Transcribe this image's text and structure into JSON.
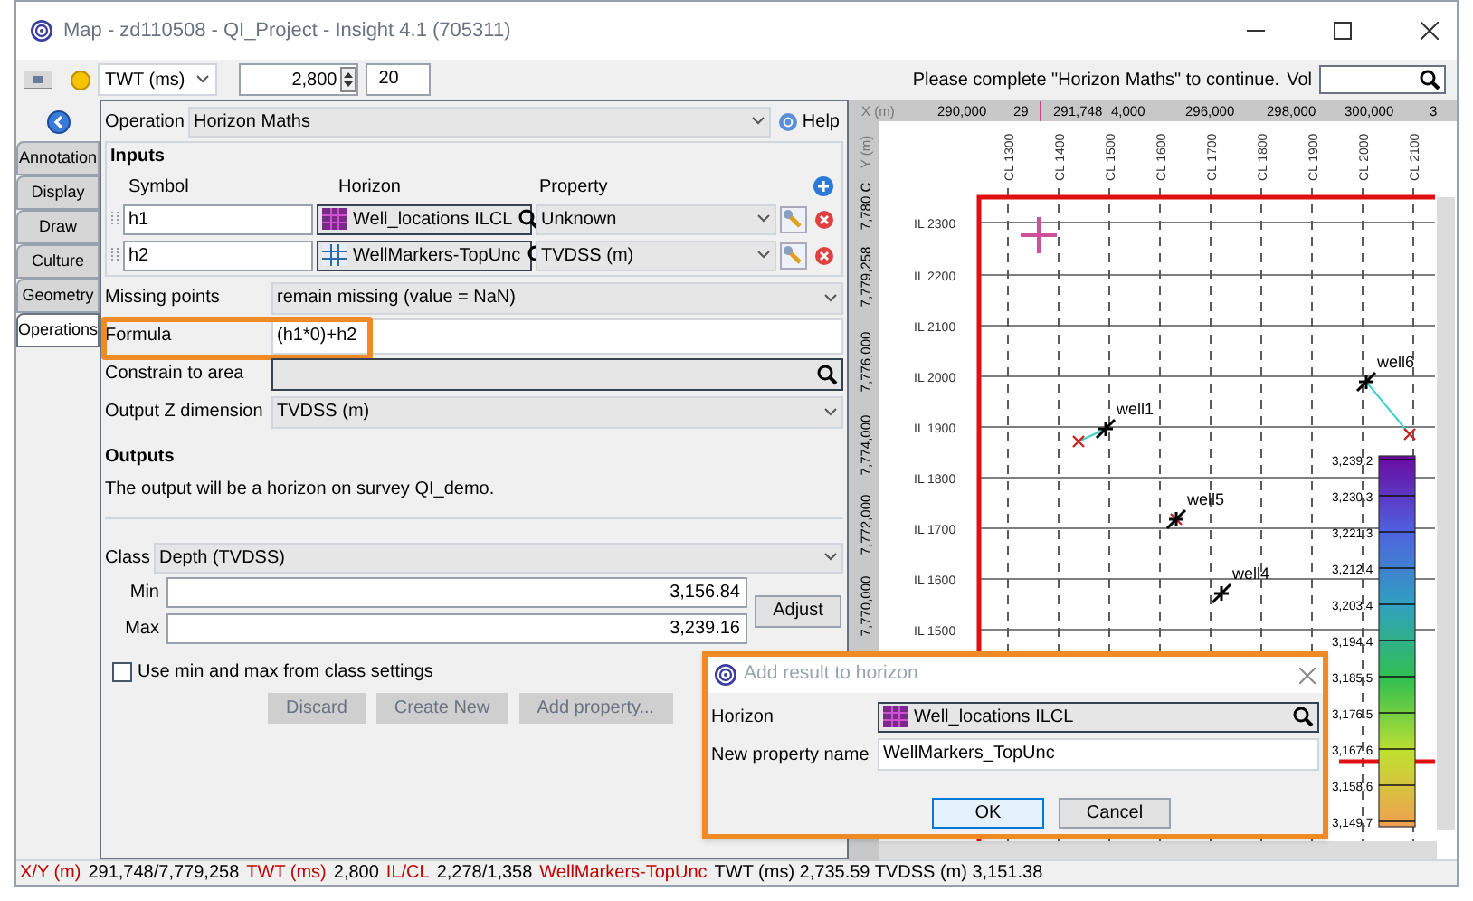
{
  "window": {
    "title": "Map - zd110508 - QI_Project - Insight 4.1 (705311)"
  },
  "toolbar": {
    "domain": "TWT (ms)",
    "value": "2,800",
    "step": "20",
    "message": "Please complete \"Horizon Maths\" to continue.",
    "vol_label": "Vol"
  },
  "side_tabs": [
    {
      "label": "Annotation",
      "selected": false
    },
    {
      "label": "Display",
      "selected": false
    },
    {
      "label": "Draw",
      "selected": false
    },
    {
      "label": "Culture",
      "selected": false
    },
    {
      "label": "Geometry",
      "selected": false
    },
    {
      "label": "Operations",
      "selected": true
    }
  ],
  "operation": {
    "label": "Operation",
    "value": "Horizon Maths",
    "help": "Help"
  },
  "inputs": {
    "title": "Inputs",
    "columns": [
      "Symbol",
      "Horizon",
      "Property"
    ],
    "rows": [
      {
        "symbol": "h1",
        "horizon": "Well_locations ILCL",
        "property": "Unknown"
      },
      {
        "symbol": "h2",
        "horizon": "WellMarkers-TopUnc",
        "property": "TVDSS (m)"
      }
    ]
  },
  "fields": [
    {
      "kind": "dropdown",
      "label": "Missing points",
      "value": "remain missing (value = NaN)",
      "highlighted": false
    },
    {
      "kind": "text",
      "label": "Formula",
      "value": "(h1*0)+h2",
      "highlighted": true
    },
    {
      "kind": "search",
      "label": "Constrain to area",
      "highlighted": false
    },
    {
      "kind": "dropdown",
      "label": "Output Z dimension",
      "value": "TVDSS (m)",
      "highlighted": false
    }
  ],
  "outputs": {
    "title": "Outputs",
    "text": "The output will be a horizon on survey QI_demo."
  },
  "class": {
    "label": "Class",
    "value": "Depth (TVDSS)",
    "min_label": "Min",
    "min": "3,156.84",
    "max_label": "Max",
    "max": "3,239.16",
    "adjust": "Adjust"
  },
  "use_class": {
    "label": "Use min and max from class settings",
    "checked": false
  },
  "buttons": [
    {
      "label": "Discard",
      "disabled": true
    },
    {
      "label": "Create New",
      "disabled": true
    },
    {
      "label": "Add property...",
      "disabled": true
    }
  ],
  "map": {
    "x_axis": [
      "X (m)",
      "290,000",
      "29",
      "291,748",
      "4,000",
      "296,000",
      "298,000",
      "300,000",
      "3"
    ],
    "y_axis": [
      "Y (m)",
      "7,780,C",
      "7,779,258",
      "7,776,000",
      "7,774,000",
      "7,772,000",
      "7,770,000"
    ],
    "crosslines": [
      "CL 1300",
      "CL 1400",
      "CL 1500",
      "CL 1600",
      "CL 1700",
      "CL 1800",
      "CL 1900",
      "CL 2000",
      "CL 2100"
    ],
    "inlines": [
      "IL 2300",
      "IL 2200",
      "IL 2100",
      "IL 2000",
      "IL 1900",
      "IL 1800",
      "IL 1700",
      "IL 1600",
      "IL 1500"
    ],
    "wells": [
      "well1",
      "well5",
      "well4",
      "well6"
    ],
    "scale": [
      "3,239.2",
      "3,230.3",
      "3,221.3",
      "3,212.4",
      "3,203.4",
      "3,194.4",
      "3,185.5",
      "3,176.5",
      "3,167.6",
      "3,158.6",
      "3,149.7"
    ]
  },
  "dialog": {
    "title": "Add result to horizon",
    "horizon_label": "Horizon",
    "horizon": "Well_locations ILCL",
    "name_label": "New property name",
    "name": "WellMarkers_TopUnc",
    "buttons": [
      "OK",
      "Cancel"
    ]
  },
  "status_bar": [
    {
      "kind": "key",
      "text": "X/Y (m)"
    },
    {
      "kind": "value",
      "text": "291,748/7,779,258"
    },
    {
      "kind": "key",
      "text": "TWT (ms)"
    },
    {
      "kind": "value",
      "text": "2,800"
    },
    {
      "kind": "key",
      "text": "IL/CL"
    },
    {
      "kind": "value",
      "text": "2,278/1,358"
    },
    {
      "kind": "key",
      "text": "WellMarkers-TopUnc"
    },
    {
      "kind": "value",
      "text": "TWT (ms) 2,735.59 TVDSS (m) 3,151.38"
    }
  ]
}
